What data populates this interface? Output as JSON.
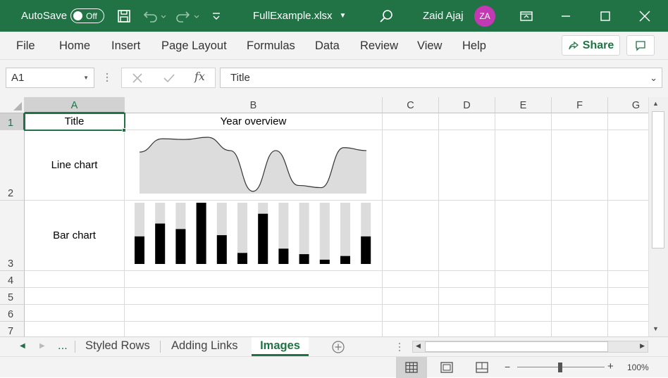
{
  "title_bar": {
    "autosave_label": "AutoSave",
    "autosave_state": "Off",
    "file_name": "FullExample.xlsx",
    "user_name": "Zaid Ajaj",
    "user_initials": "ZA"
  },
  "menu": {
    "items": [
      "File",
      "Home",
      "Insert",
      "Page Layout",
      "Formulas",
      "Data",
      "Review",
      "View",
      "Help"
    ],
    "share_label": "Share"
  },
  "formula_bar": {
    "name_box": "A1",
    "fx_label": "fx",
    "formula": "Title"
  },
  "columns": [
    "A",
    "B",
    "C",
    "D",
    "E",
    "F",
    "G"
  ],
  "rows": [
    "1",
    "2",
    "3",
    "4",
    "5",
    "6",
    "7"
  ],
  "cells": {
    "A1": "Title",
    "B1": "Year overview",
    "A2": "Line chart",
    "A3": "Bar chart"
  },
  "line_chart": {
    "type": "area",
    "values": [
      56,
      74,
      73,
      76,
      58,
      3,
      58,
      11,
      8,
      62,
      58
    ]
  },
  "bar_chart": {
    "type": "bar",
    "values": [
      45,
      66,
      57,
      100,
      47,
      18,
      82,
      25,
      16,
      7,
      13,
      45
    ],
    "max": 100,
    "bar_color": "#000000",
    "track_color": "#dcdcdc"
  },
  "sheet_tabs": {
    "ellipsis": "...",
    "tabs": [
      "Styled Rows",
      "Adding Links",
      "Images"
    ],
    "active": "Images"
  },
  "status_bar": {
    "zoom": "100%"
  },
  "colors": {
    "accent": "#217346",
    "avatar": "#c239b3"
  }
}
